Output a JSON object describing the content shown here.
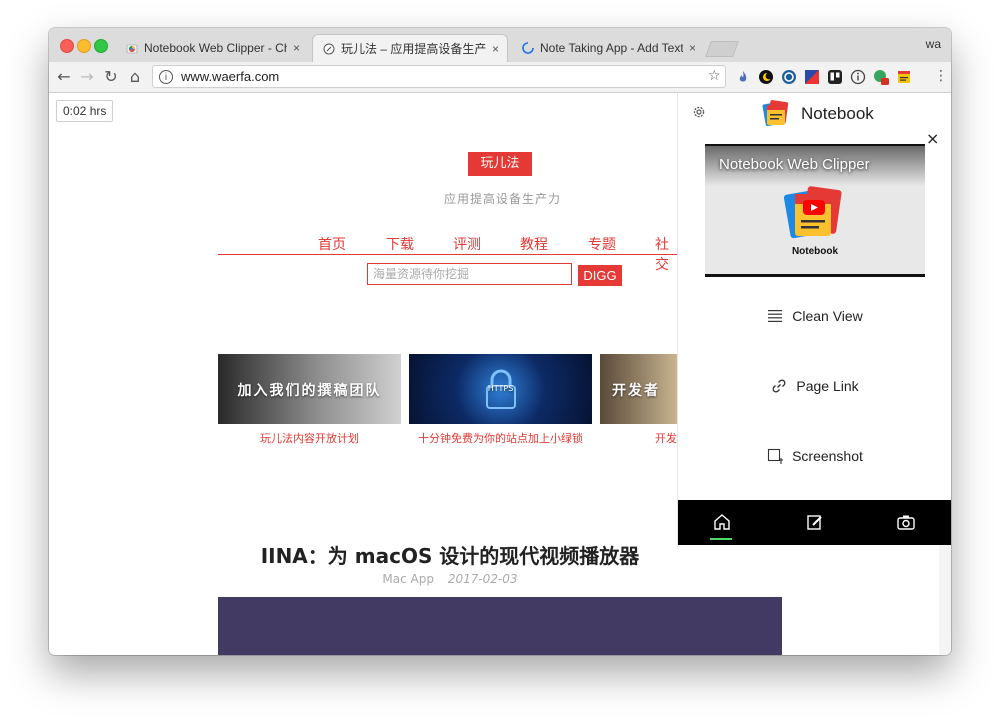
{
  "browser": {
    "tabs": [
      {
        "title": "Notebook Web Clipper - Chrome Web Store",
        "active": false
      },
      {
        "title": "玩儿法 – 应用提高设备生产力",
        "active": true
      },
      {
        "title": "Note Taking App - Add Text, Images",
        "active": false
      }
    ],
    "close_glyph": "×",
    "profile": "wa",
    "url": "www.waerfa.com",
    "nav_icons": [
      "back-icon",
      "forward-icon",
      "reload-icon",
      "home-icon"
    ],
    "extension_icons": [
      "flame-icon",
      "moon-icon",
      "compass-icon",
      "flag-icon",
      "trello-icon",
      "info-icon",
      "globe-badge-icon",
      "notebook-ext-icon"
    ]
  },
  "page": {
    "timer": "0:02 hrs",
    "logo": "玩儿法",
    "tagline": "应用提高设备生产力",
    "nav": [
      "首页",
      "下载",
      "评测",
      "教程",
      "专题",
      "社交"
    ],
    "search_placeholder": "海量资源待你挖掘",
    "search_button": "DIGG",
    "features": [
      {
        "overlay": "加入我们的撰稿团队",
        "caption": "玩儿法内容开放计划"
      },
      {
        "overlay": "HTTPS",
        "caption": "十分钟免费为你的站点加上小绿锁"
      },
      {
        "overlay": "开发者",
        "caption": "开发"
      }
    ],
    "article": {
      "title": "IINA：为 macOS 设计的现代视频播放器",
      "category": "Mac App",
      "date": "2017-02-03"
    }
  },
  "panel": {
    "title": "Notebook",
    "close": "×",
    "video_title": "Notebook Web Clipper",
    "video_logo_caption": "Notebook",
    "actions": [
      {
        "label": "Clean View",
        "icon": "lines-icon"
      },
      {
        "label": "Page Link",
        "icon": "link-icon"
      },
      {
        "label": "Screenshot",
        "icon": "screenshot-icon"
      }
    ],
    "footer_icons": [
      "home-icon",
      "edit-icon",
      "camera-icon"
    ],
    "colors": {
      "accent": "#e53935",
      "footer": "#000000",
      "active_indicator": "#4cd964"
    }
  }
}
